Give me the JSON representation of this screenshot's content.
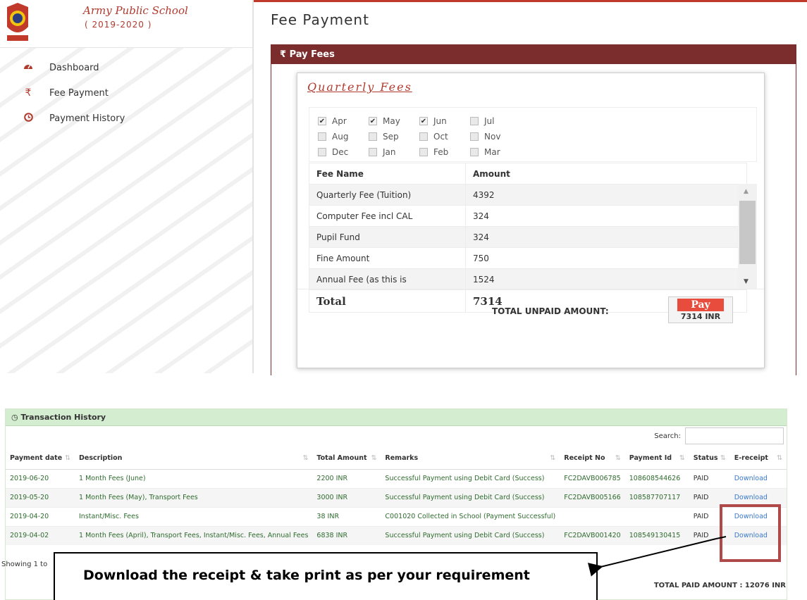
{
  "brand": {
    "name": "Army Public School",
    "year": "( 2019-2020 )"
  },
  "sidebar": {
    "items": [
      {
        "label": "Dashboard",
        "icon": "tachometer-icon"
      },
      {
        "label": "Fee Payment",
        "icon": "rupee-icon"
      },
      {
        "label": "Payment History",
        "icon": "clock-icon"
      }
    ]
  },
  "header": {
    "title": "Fee Payment"
  },
  "pay_panel": {
    "title": "₹ Pay Fees",
    "section_title": "Quarterly Fees",
    "months": [
      {
        "label": "Apr",
        "checked": true
      },
      {
        "label": "May",
        "checked": true
      },
      {
        "label": "Jun",
        "checked": true
      },
      {
        "label": "Jul",
        "checked": false
      },
      {
        "label": "Aug",
        "checked": false
      },
      {
        "label": "Sep",
        "checked": false
      },
      {
        "label": "Oct",
        "checked": false
      },
      {
        "label": "Nov",
        "checked": false
      },
      {
        "label": "Dec",
        "checked": false
      },
      {
        "label": "Jan",
        "checked": false
      },
      {
        "label": "Feb",
        "checked": false
      },
      {
        "label": "Mar",
        "checked": false
      }
    ],
    "table": {
      "headers": [
        "Fee Name",
        "Amount"
      ],
      "rows": [
        [
          "Quarterly Fee (Tuition)",
          "4392"
        ],
        [
          "Computer Fee incl CAL",
          "324"
        ],
        [
          "Pupil Fund",
          "324"
        ],
        [
          "Fine Amount",
          "750"
        ],
        [
          "Annual Fee (as this is",
          "1524"
        ]
      ],
      "total_label": "Total",
      "total_value": "7314"
    },
    "unpaid_label": "TOTAL UNPAID AMOUNT:",
    "pay_button": {
      "label": "Pay",
      "amount": "7314 INR"
    }
  },
  "transactions": {
    "title": "Transaction History",
    "search_label": "Search:",
    "headers": [
      "Payment date",
      "Description",
      "Total Amount",
      "Remarks",
      "Receipt No",
      "Payment Id",
      "Status",
      "E-receipt"
    ],
    "rows": [
      [
        "2019-06-20",
        "1 Month Fees (June)",
        "2200 INR",
        "Successful Payment using Debit Card (Success)",
        "FC2DAVB006785",
        "108608544626",
        "PAID",
        "Download"
      ],
      [
        "2019-05-20",
        "1 Month Fees (May), Transport Fees",
        "3000 INR",
        "Successful Payment using Debit Card (Success)",
        "FC2DAVB005166",
        "108587707117",
        "PAID",
        "Download"
      ],
      [
        "2019-04-20",
        "Instant/Misc. Fees",
        "38 INR",
        "C001020 Collected in School (Payment Successful)",
        "",
        "",
        "PAID",
        "Download"
      ],
      [
        "2019-04-02",
        "1 Month Fees (April), Transport Fees, Instant/Misc. Fees, Annual Fees",
        "6838 INR",
        "Successful Payment using Debit Card (Success)",
        "FC2DAVB001420",
        "108549130415",
        "PAID",
        "Download"
      ]
    ],
    "showing": "Showing 1 to",
    "total_paid": "TOTAL PAID AMOUNT : 12076 INR"
  },
  "callout": {
    "text": "Download the receipt & take print as per your requirement"
  },
  "colors": {
    "brand": "#b03a2e",
    "panel_header": "#7b2d2d",
    "tx_header": "#d4ecd0",
    "link": "#3a78c9",
    "pay_button": "#e74c3c"
  }
}
